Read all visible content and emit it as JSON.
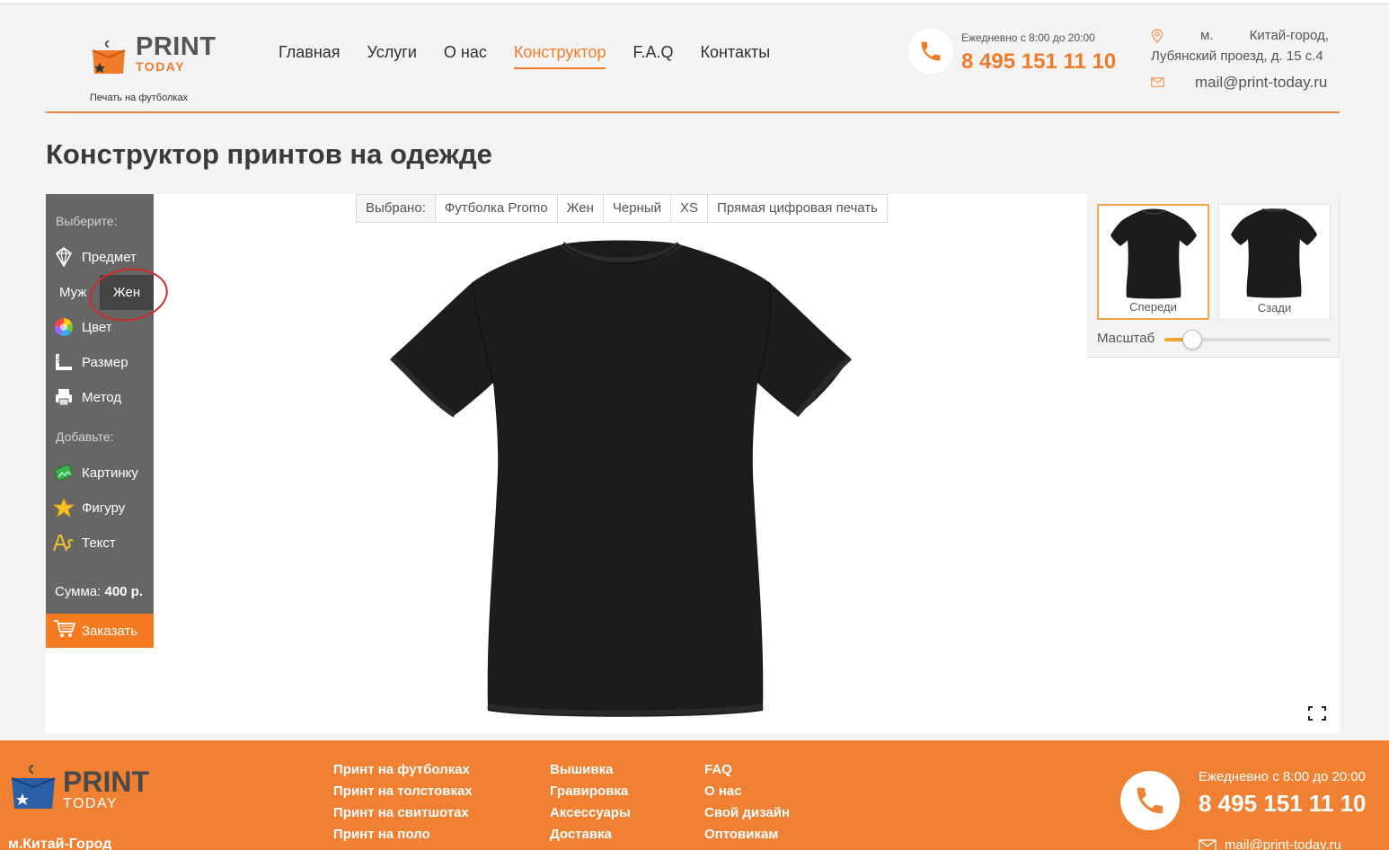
{
  "header": {
    "logo_print": "PRINT",
    "logo_today": "TODAY",
    "logo_tagline": "Печать на футболках",
    "nav": [
      {
        "label": "Главная",
        "active": false
      },
      {
        "label": "Услуги",
        "active": false
      },
      {
        "label": "О нас",
        "active": false
      },
      {
        "label": "Конструктор",
        "active": true
      },
      {
        "label": "F.A.Q",
        "active": false
      },
      {
        "label": "Контакты",
        "active": false
      }
    ],
    "hours": "Ежедневно с 8:00 до 20:00",
    "phone": "8 495 151 11 10",
    "address_line1": "м. Китай-город,",
    "address_line2": "Лубянский проезд, д. 15 с.4",
    "email": "mail@print-today.ru"
  },
  "page_title": "Конструктор принтов на одежде",
  "sidebar": {
    "choose_label": "Выберите:",
    "item_label": "Предмет",
    "gender_male": "Муж",
    "gender_female": "Жен",
    "color_label": "Цвет",
    "size_label": "Размер",
    "method_label": "Метод",
    "add_label": "Добавьте:",
    "picture_label": "Картинку",
    "shape_label": "Фигуру",
    "text_label": "Текст",
    "sum_label": "Сумма:",
    "sum_value": "400 р.",
    "order_label": "Заказать"
  },
  "selection": {
    "label": "Выбрано:",
    "product": "Футболка Promo",
    "gender": "Жен",
    "color": "Черный",
    "size": "XS",
    "method": "Прямая цифровая печать"
  },
  "views": {
    "front_label": "Спереди",
    "back_label": "Сзади",
    "scale_label": "Масштаб",
    "scale_value": 0.17
  },
  "colors": {
    "accent": "#f07b2b",
    "sidebar_bg": "#666666",
    "order_button": "#f57b20",
    "footer_bg": "#f08133",
    "shirt": "#1c1c1c"
  },
  "footer": {
    "logo_print": "PRINT",
    "logo_today": "TODAY",
    "metro": "м.Китай-Город",
    "col1": [
      "Принт на футболках",
      "Принт на толстовках",
      "Принт на свитшотах",
      "Принт на поло"
    ],
    "col2": [
      "Вышивка",
      "Гравировка",
      "Аксессуары",
      "Доставка"
    ],
    "col3": [
      "FAQ",
      "О нас",
      "Свой дизайн",
      "Оптовикам"
    ],
    "hours": "Ежедневно с 8:00 до 20:00",
    "phone": "8 495 151 11 10",
    "email": "mail@print-today.ru"
  }
}
